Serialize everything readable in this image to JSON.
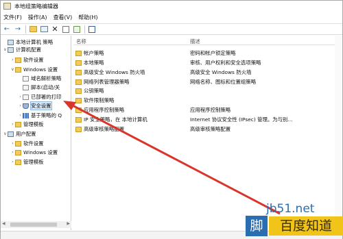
{
  "window": {
    "title": "本地组策略编辑器"
  },
  "menubar": {
    "items": [
      "文件(F)",
      "操作(A)",
      "查看(V)",
      "帮助(H)"
    ]
  },
  "toolbar": {
    "icons": [
      "back-icon",
      "forward-icon",
      "up-folder-icon",
      "show-hide-tree-icon",
      "delete-icon",
      "properties-icon",
      "export-icon",
      "help-icon"
    ]
  },
  "tree": {
    "items": [
      {
        "label": "本地计算机 策略",
        "level": 0,
        "arrow": "",
        "icon": "pc"
      },
      {
        "label": "计算机配置",
        "level": 1,
        "arrow": "v",
        "icon": "pc"
      },
      {
        "label": "软件设置",
        "level": 2,
        "arrow": ">",
        "icon": "folder"
      },
      {
        "label": "Windows 设置",
        "level": 2,
        "arrow": "v",
        "icon": "folder"
      },
      {
        "label": "域名解析策略",
        "level": 3,
        "arrow": "",
        "icon": "doc"
      },
      {
        "label": "脚本(启动/关",
        "level": 3,
        "arrow": "",
        "icon": "doc"
      },
      {
        "label": "已部署的打印",
        "level": 3,
        "arrow": ">",
        "icon": "doc"
      },
      {
        "label": "安全设置",
        "level": 3,
        "arrow": ">",
        "icon": "shield"
      },
      {
        "label": "基于策略的 Q",
        "level": 3,
        "arrow": ">",
        "icon": "bars"
      },
      {
        "label": "管理模板",
        "level": 2,
        "arrow": ">",
        "icon": "folder"
      },
      {
        "label": "用户配置",
        "level": 1,
        "arrow": "v",
        "icon": "pc"
      },
      {
        "label": "软件设置",
        "level": 2,
        "arrow": ">",
        "icon": "folder"
      },
      {
        "label": "Windows 设置",
        "level": 2,
        "arrow": ">",
        "icon": "folder"
      },
      {
        "label": "管理模板",
        "level": 2,
        "arrow": ">",
        "icon": "folder"
      }
    ]
  },
  "list": {
    "headers": {
      "name": "名称",
      "desc": "描述"
    },
    "rows": [
      {
        "name": "帐户策略",
        "desc": "密码和帐户锁定策略"
      },
      {
        "name": "本地策略",
        "desc": "审核、用户权利和安全选项策略"
      },
      {
        "name": "高级安全 Windows 防火墙",
        "desc": "高级安全 Windows 防火墙"
      },
      {
        "name": "网络列表管理器策略",
        "desc": "网络名称、图标和位置组策略"
      },
      {
        "name": "公钥策略",
        "desc": ""
      },
      {
        "name": "软件限制策略",
        "desc": ""
      },
      {
        "name": "应用程序控制策略",
        "desc": "应用程序控制策略"
      },
      {
        "name": "IP 安全策略，在 本地计算机",
        "desc": "Internet 协议安全性 (IPsec) 管理。为与别..."
      },
      {
        "name": "高级审核策略配置",
        "desc": "高级审核策略配置"
      }
    ]
  },
  "watermark": {
    "url": "jb51.net",
    "jiao": "脚",
    "baidu": "百度知道"
  },
  "colors": {
    "annotation": "#d9352c",
    "selection": "#d9e8f7",
    "folder": "#f2cc5a"
  }
}
